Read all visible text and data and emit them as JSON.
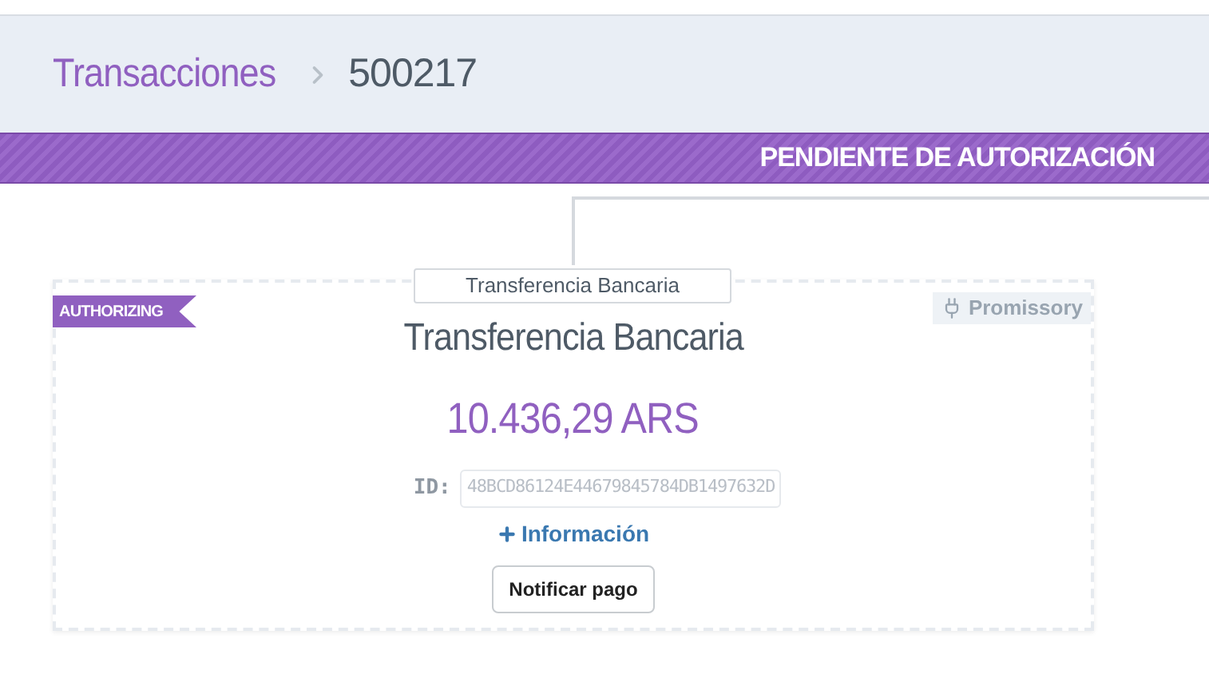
{
  "breadcrumb": {
    "parent": "Transacciones",
    "current": "500217"
  },
  "status_banner": "PENDIENTE DE AUTORIZACIÓN",
  "card": {
    "tag": "Transferencia Bancaria",
    "ribbon": "AUTHORIZING",
    "badge": "Promissory",
    "title": "Transferencia Bancaria",
    "amount": "10.436,29 ARS",
    "id_label": "ID:",
    "id_value": "48BCD86124E44679845784DB1497632D",
    "info_link": "Información",
    "button": "Notificar pago"
  }
}
